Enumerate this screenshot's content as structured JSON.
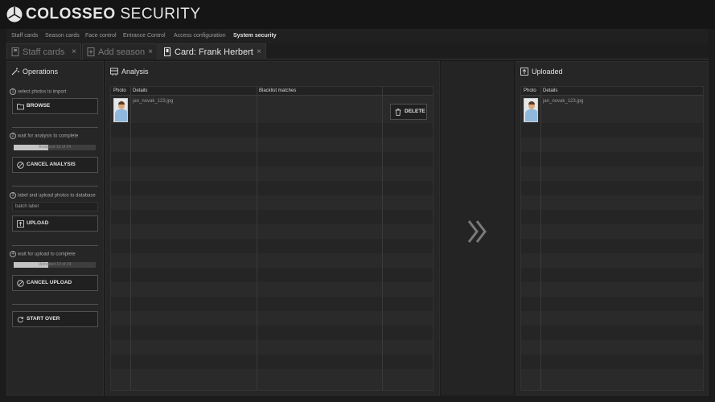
{
  "app": {
    "brand_bold": "COLOSSEO",
    "brand_light": "SECURITY"
  },
  "nav": [
    {
      "label": "Staff cards"
    },
    {
      "label": "Season cards"
    },
    {
      "label": "Face control"
    },
    {
      "label": "Entrance Control"
    },
    {
      "label": "Access configuration"
    },
    {
      "label": "System security",
      "active": true
    }
  ],
  "tabs": [
    {
      "label": "Staff cards",
      "close": "×"
    },
    {
      "label": "Add season",
      "close": "×"
    },
    {
      "label": "Card: Frank Herbert",
      "close": "×",
      "active": true
    }
  ],
  "operations": {
    "title": "Operations",
    "step1": {
      "num": "1",
      "text": "select photos to import",
      "button": "BROWSE"
    },
    "step2": {
      "num": "2",
      "text": "wait for analysis to complete",
      "progress_text": "Analyzed 10 of 24",
      "progress_fraction": 0.42,
      "button": "CANCEL ANALYSIS"
    },
    "step3": {
      "num": "3",
      "text": "label and upload photos to database",
      "batch_placeholder": "batch label",
      "button": "UPLOAD"
    },
    "step4": {
      "num": "4",
      "text": "wait for upload to complete",
      "progress_text": "Uploaded 10 of 24",
      "progress_fraction": 0.42,
      "button": "CANCEL UPLOAD"
    },
    "start_over": "START OVER"
  },
  "analysis": {
    "title": "Analysis",
    "columns": [
      "Photo",
      "Details",
      "Blacklist matches"
    ],
    "rows": [
      {
        "filename": "jan_novak_123.jpg",
        "action": "DELETE"
      }
    ]
  },
  "uploaded": {
    "title": "Uploaded",
    "columns": [
      "Photo",
      "Details"
    ],
    "rows": [
      {
        "filename": "jan_novak_123.jpg"
      }
    ]
  },
  "colors": {
    "background": "#1c1c1c",
    "panel": "#262626",
    "text": "#e4e4e4",
    "progress_fill": "#c4c4c4"
  },
  "icons": [
    "colosseo-logo-icon",
    "card-icon",
    "wand-icon",
    "analysis-icon",
    "upload-icon",
    "folder-icon",
    "cancel-icon",
    "refresh-icon",
    "trash-icon",
    "double-chevron-right-icon"
  ]
}
